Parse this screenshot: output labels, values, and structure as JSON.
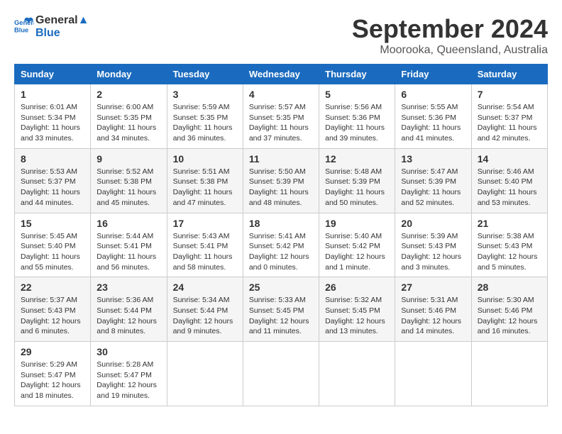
{
  "header": {
    "logo_line1": "General",
    "logo_line2": "Blue",
    "month": "September 2024",
    "location": "Moorooka, Queensland, Australia"
  },
  "weekdays": [
    "Sunday",
    "Monday",
    "Tuesday",
    "Wednesday",
    "Thursday",
    "Friday",
    "Saturday"
  ],
  "weeks": [
    [
      {
        "day": "1",
        "info": "Sunrise: 6:01 AM\nSunset: 5:34 PM\nDaylight: 11 hours\nand 33 minutes."
      },
      {
        "day": "2",
        "info": "Sunrise: 6:00 AM\nSunset: 5:35 PM\nDaylight: 11 hours\nand 34 minutes."
      },
      {
        "day": "3",
        "info": "Sunrise: 5:59 AM\nSunset: 5:35 PM\nDaylight: 11 hours\nand 36 minutes."
      },
      {
        "day": "4",
        "info": "Sunrise: 5:57 AM\nSunset: 5:35 PM\nDaylight: 11 hours\nand 37 minutes."
      },
      {
        "day": "5",
        "info": "Sunrise: 5:56 AM\nSunset: 5:36 PM\nDaylight: 11 hours\nand 39 minutes."
      },
      {
        "day": "6",
        "info": "Sunrise: 5:55 AM\nSunset: 5:36 PM\nDaylight: 11 hours\nand 41 minutes."
      },
      {
        "day": "7",
        "info": "Sunrise: 5:54 AM\nSunset: 5:37 PM\nDaylight: 11 hours\nand 42 minutes."
      }
    ],
    [
      {
        "day": "8",
        "info": "Sunrise: 5:53 AM\nSunset: 5:37 PM\nDaylight: 11 hours\nand 44 minutes."
      },
      {
        "day": "9",
        "info": "Sunrise: 5:52 AM\nSunset: 5:38 PM\nDaylight: 11 hours\nand 45 minutes."
      },
      {
        "day": "10",
        "info": "Sunrise: 5:51 AM\nSunset: 5:38 PM\nDaylight: 11 hours\nand 47 minutes."
      },
      {
        "day": "11",
        "info": "Sunrise: 5:50 AM\nSunset: 5:39 PM\nDaylight: 11 hours\nand 48 minutes."
      },
      {
        "day": "12",
        "info": "Sunrise: 5:48 AM\nSunset: 5:39 PM\nDaylight: 11 hours\nand 50 minutes."
      },
      {
        "day": "13",
        "info": "Sunrise: 5:47 AM\nSunset: 5:39 PM\nDaylight: 11 hours\nand 52 minutes."
      },
      {
        "day": "14",
        "info": "Sunrise: 5:46 AM\nSunset: 5:40 PM\nDaylight: 11 hours\nand 53 minutes."
      }
    ],
    [
      {
        "day": "15",
        "info": "Sunrise: 5:45 AM\nSunset: 5:40 PM\nDaylight: 11 hours\nand 55 minutes."
      },
      {
        "day": "16",
        "info": "Sunrise: 5:44 AM\nSunset: 5:41 PM\nDaylight: 11 hours\nand 56 minutes."
      },
      {
        "day": "17",
        "info": "Sunrise: 5:43 AM\nSunset: 5:41 PM\nDaylight: 11 hours\nand 58 minutes."
      },
      {
        "day": "18",
        "info": "Sunrise: 5:41 AM\nSunset: 5:42 PM\nDaylight: 12 hours\nand 0 minutes."
      },
      {
        "day": "19",
        "info": "Sunrise: 5:40 AM\nSunset: 5:42 PM\nDaylight: 12 hours\nand 1 minute."
      },
      {
        "day": "20",
        "info": "Sunrise: 5:39 AM\nSunset: 5:43 PM\nDaylight: 12 hours\nand 3 minutes."
      },
      {
        "day": "21",
        "info": "Sunrise: 5:38 AM\nSunset: 5:43 PM\nDaylight: 12 hours\nand 5 minutes."
      }
    ],
    [
      {
        "day": "22",
        "info": "Sunrise: 5:37 AM\nSunset: 5:43 PM\nDaylight: 12 hours\nand 6 minutes."
      },
      {
        "day": "23",
        "info": "Sunrise: 5:36 AM\nSunset: 5:44 PM\nDaylight: 12 hours\nand 8 minutes."
      },
      {
        "day": "24",
        "info": "Sunrise: 5:34 AM\nSunset: 5:44 PM\nDaylight: 12 hours\nand 9 minutes."
      },
      {
        "day": "25",
        "info": "Sunrise: 5:33 AM\nSunset: 5:45 PM\nDaylight: 12 hours\nand 11 minutes."
      },
      {
        "day": "26",
        "info": "Sunrise: 5:32 AM\nSunset: 5:45 PM\nDaylight: 12 hours\nand 13 minutes."
      },
      {
        "day": "27",
        "info": "Sunrise: 5:31 AM\nSunset: 5:46 PM\nDaylight: 12 hours\nand 14 minutes."
      },
      {
        "day": "28",
        "info": "Sunrise: 5:30 AM\nSunset: 5:46 PM\nDaylight: 12 hours\nand 16 minutes."
      }
    ],
    [
      {
        "day": "29",
        "info": "Sunrise: 5:29 AM\nSunset: 5:47 PM\nDaylight: 12 hours\nand 18 minutes."
      },
      {
        "day": "30",
        "info": "Sunrise: 5:28 AM\nSunset: 5:47 PM\nDaylight: 12 hours\nand 19 minutes."
      },
      {
        "day": "",
        "info": ""
      },
      {
        "day": "",
        "info": ""
      },
      {
        "day": "",
        "info": ""
      },
      {
        "day": "",
        "info": ""
      },
      {
        "day": "",
        "info": ""
      }
    ]
  ]
}
